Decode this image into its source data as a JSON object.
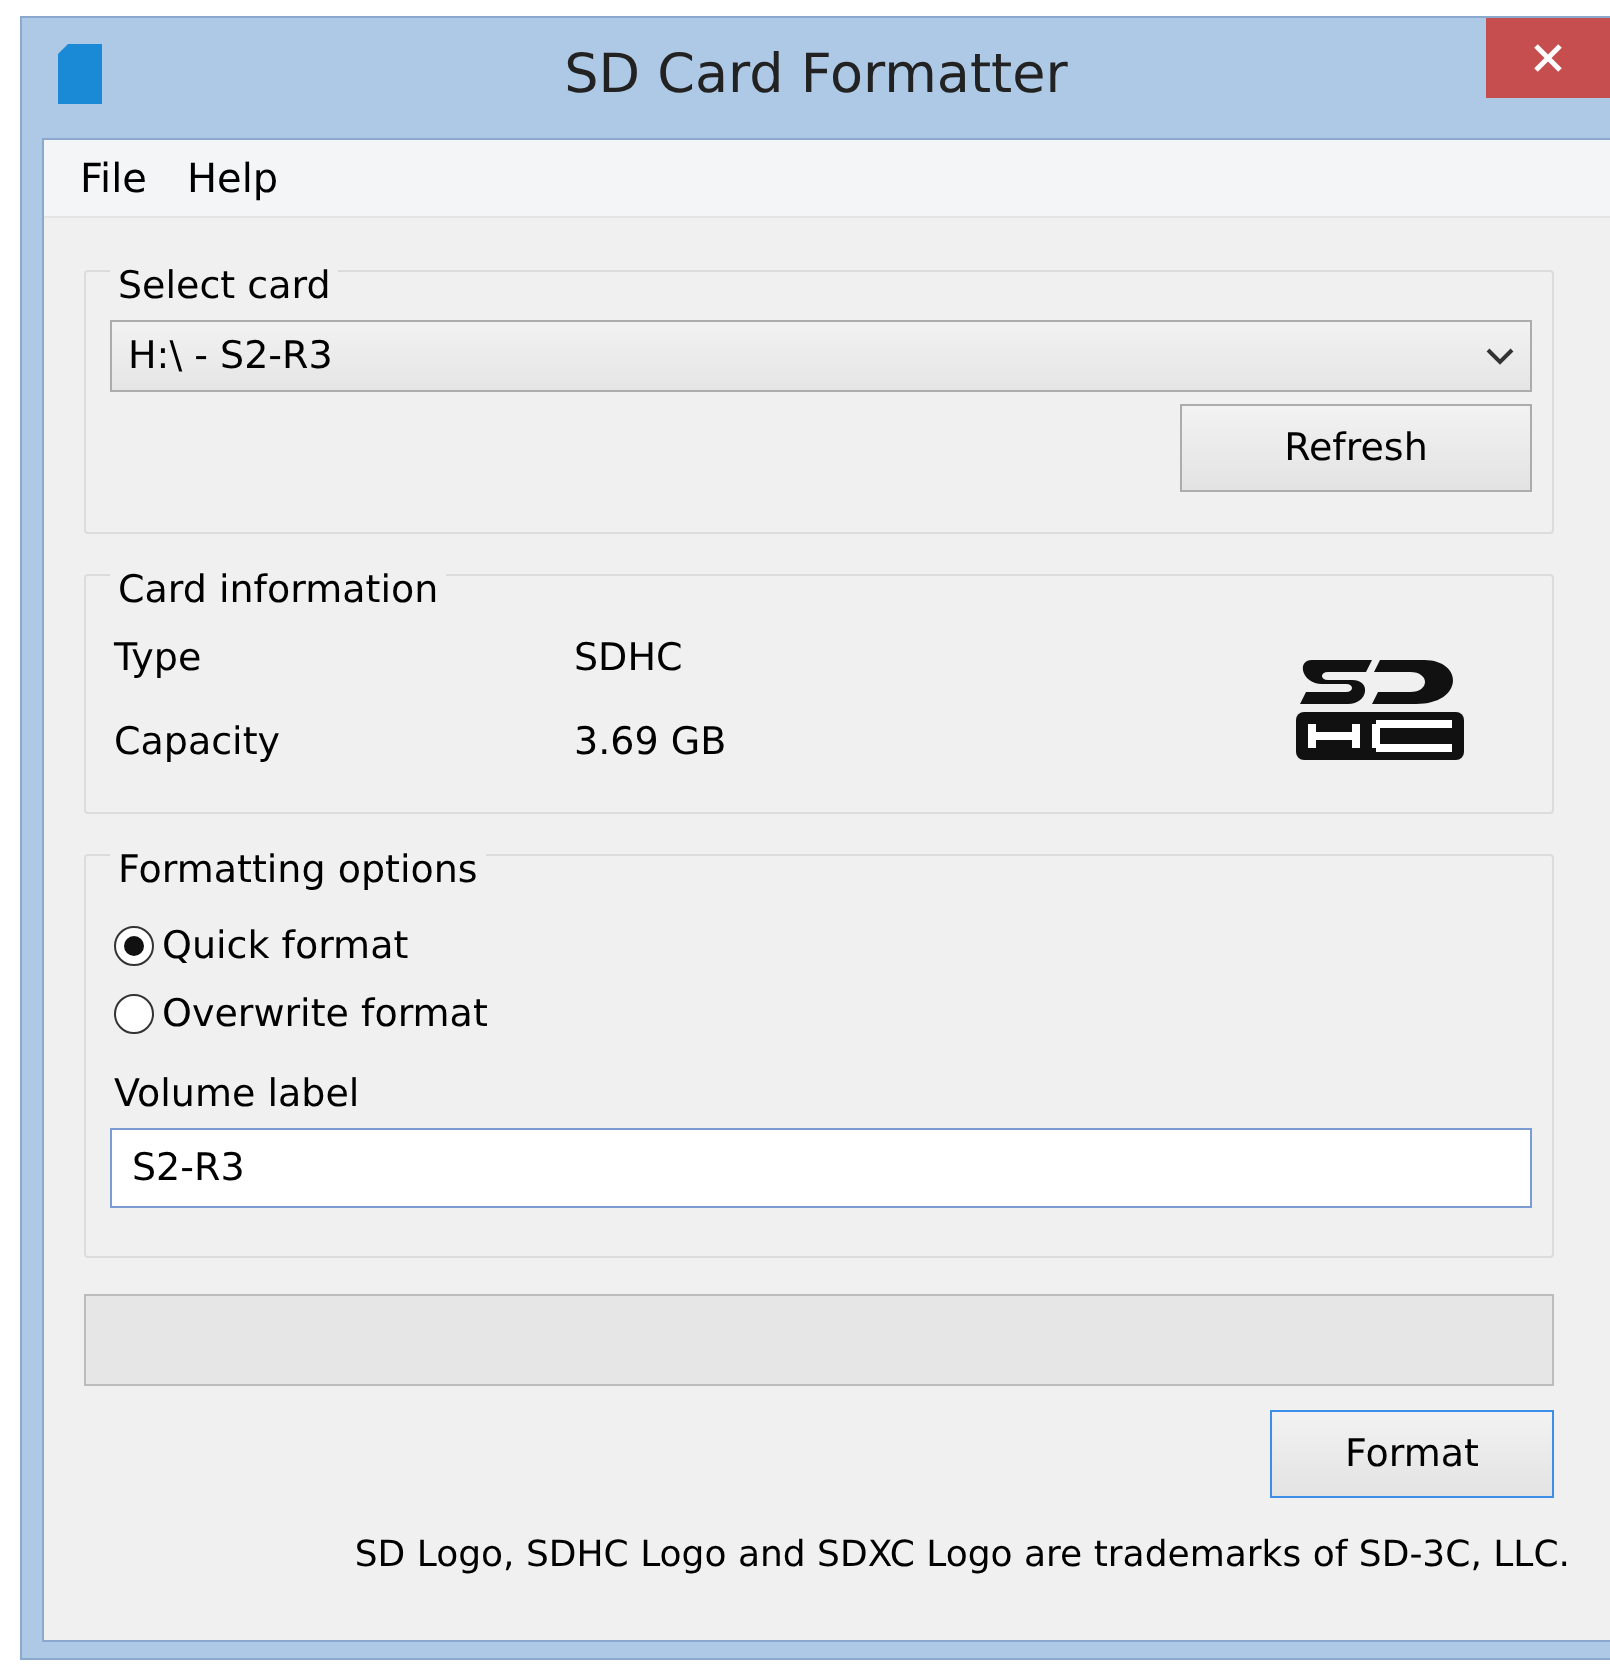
{
  "window": {
    "title": "SD Card Formatter"
  },
  "menu": [
    {
      "label": "File"
    },
    {
      "label": "Help"
    }
  ],
  "select_card": {
    "title": "Select card",
    "value": "H:\\ - S2-R3",
    "refresh": "Refresh"
  },
  "card_information": {
    "title": "Card information",
    "rows": [
      {
        "label": "Type",
        "value": "SDHC"
      },
      {
        "label": "Capacity",
        "value": "3.69 GB"
      }
    ]
  },
  "formatting_options": {
    "title": "Formatting options",
    "options": [
      {
        "label": "Quick format",
        "selected": true
      },
      {
        "label": "Overwrite format",
        "selected": false
      }
    ],
    "volume_label": {
      "label": "Volume label",
      "value": "S2-R3"
    }
  },
  "format_button": "Format",
  "footer": "SD Logo, SDHC Logo and SDXC Logo are trademarks of SD-3C, LLC."
}
